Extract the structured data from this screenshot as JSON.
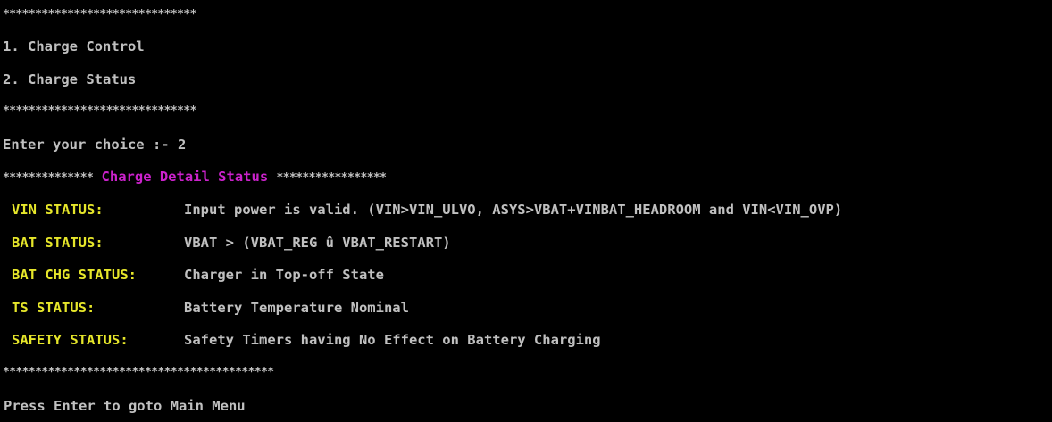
{
  "console": {
    "separator_top": "******************************",
    "menu_items": [
      "1. Charge Control",
      "2. Charge Status"
    ],
    "separator_mid": "******************************",
    "prompt": "Enter your choice :- 2",
    "detail_header": {
      "left_stars": "**************",
      "title": "Charge Detail Status",
      "right_stars": "*****************"
    },
    "statuses": [
      {
        "label": "VIN STATUS:",
        "value": "Input power is valid. (VIN>VIN_ULVO, ASYS>VBAT+VINBAT_HEADROOM and VIN<VIN_OVP)"
      },
      {
        "label": "BAT STATUS:",
        "value": "VBAT > (VBAT_REG û VBAT_RESTART)"
      },
      {
        "label": "BAT CHG STATUS:",
        "value": "Charger in Top-off State"
      },
      {
        "label": "TS STATUS:",
        "value": "Battery Temperature Nominal"
      },
      {
        "label": "SAFETY STATUS:",
        "value": "Safety Timers having No Effect on Battery Charging"
      }
    ],
    "separator_bottom": "******************************************",
    "footer_prompt": "Press Enter to goto Main Menu"
  },
  "colors": {
    "background": "#000000",
    "text": "#c0c0c0",
    "header_title": "#cc22cc",
    "status_label": "#e6e62a"
  }
}
